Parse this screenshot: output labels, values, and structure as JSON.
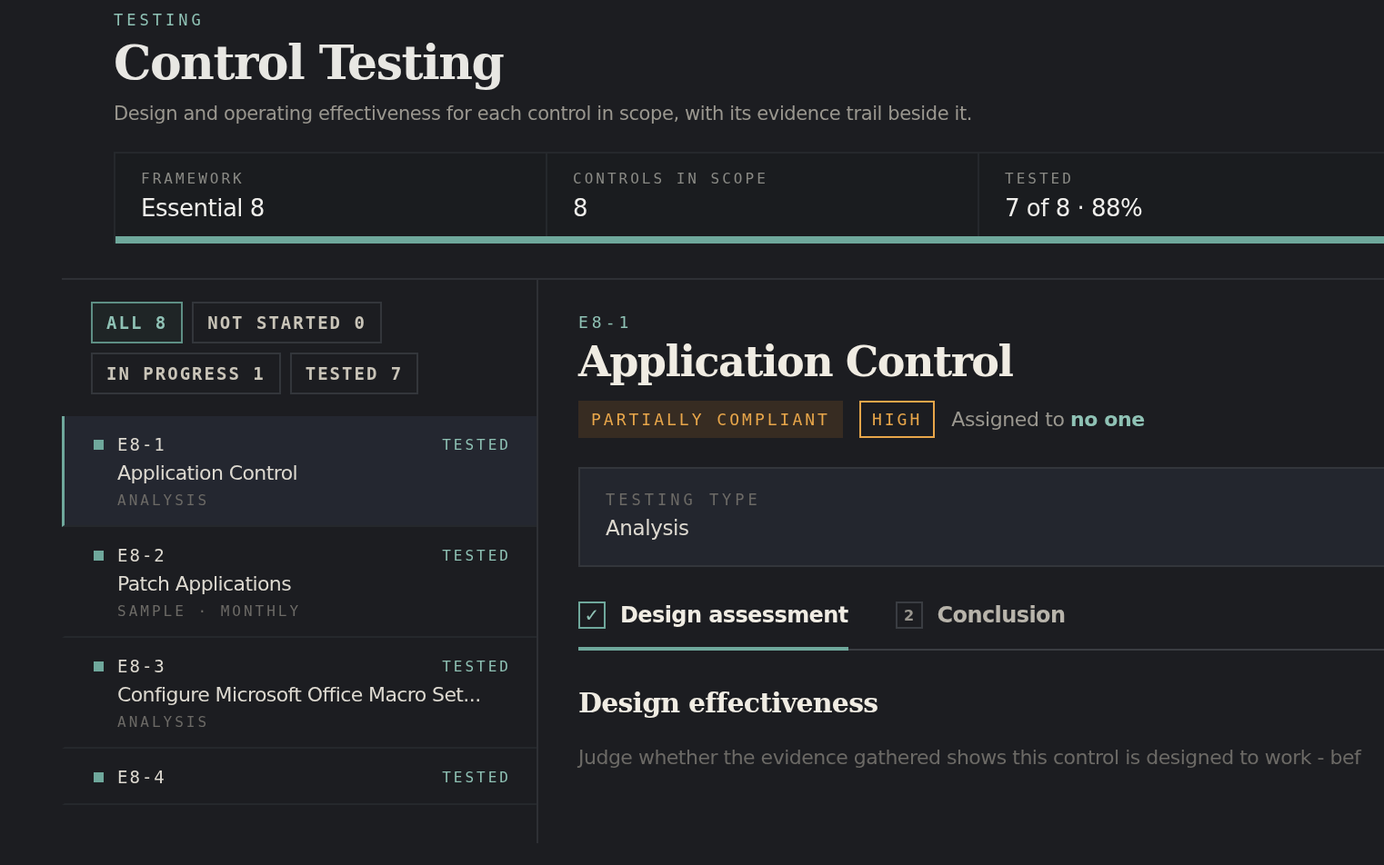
{
  "header": {
    "eyebrow": "TESTING",
    "title": "Control Testing",
    "subtitle": "Design and operating effectiveness for each control in scope, with its evidence trail beside it."
  },
  "stats": {
    "items": [
      {
        "label": "FRAMEWORK",
        "value": "Essential 8"
      },
      {
        "label": "CONTROLS IN SCOPE",
        "value": "8"
      },
      {
        "label": "TESTED",
        "value": "7 of 8 · 88%"
      }
    ],
    "level": 0.88
  },
  "filters": [
    {
      "label": "ALL 8",
      "selected": true
    },
    {
      "label": "NOT STARTED 0",
      "selected": false
    },
    {
      "label": "IN PROGRESS 1",
      "selected": false
    },
    {
      "label": "TESTED 7",
      "selected": false
    }
  ],
  "controls": [
    {
      "id": "E8-1",
      "status": "TESTED",
      "name": "Application Control",
      "meta": "ANALYSIS",
      "color": "#6fa89c",
      "selected": true
    },
    {
      "id": "E8-2",
      "status": "TESTED",
      "name": "Patch Applications",
      "meta": "SAMPLE · MONTHLY",
      "color": "#6fa89c",
      "selected": false
    },
    {
      "id": "E8-3",
      "status": "TESTED",
      "name": "Configure Microsoft Office Macro Set...",
      "meta": "ANALYSIS",
      "color": "#6fa89c",
      "selected": false
    },
    {
      "id": "E8-4",
      "status": "TESTED",
      "color": "#6fa89c",
      "selected": false
    }
  ],
  "detail": {
    "id": "E8-1",
    "title": "Application Control",
    "badges": [
      {
        "label": "PARTIALLY COMPLIANT",
        "kind": "filled"
      },
      {
        "label": "HIGH",
        "kind": "outlined"
      }
    ],
    "assigned": "Assigned to **no one**",
    "field": {
      "label": "TESTING TYPE",
      "value": "Analysis"
    },
    "steps": [
      {
        "marker": "✓",
        "label": "Design assessment",
        "done": true,
        "selected": true
      },
      {
        "marker": "2",
        "label": "Conclusion",
        "done": false,
        "selected": false
      }
    ],
    "section_title": "Design effectiveness",
    "section_text": "Judge whether the evidence gathered shows this control is designed to work - bef"
  }
}
